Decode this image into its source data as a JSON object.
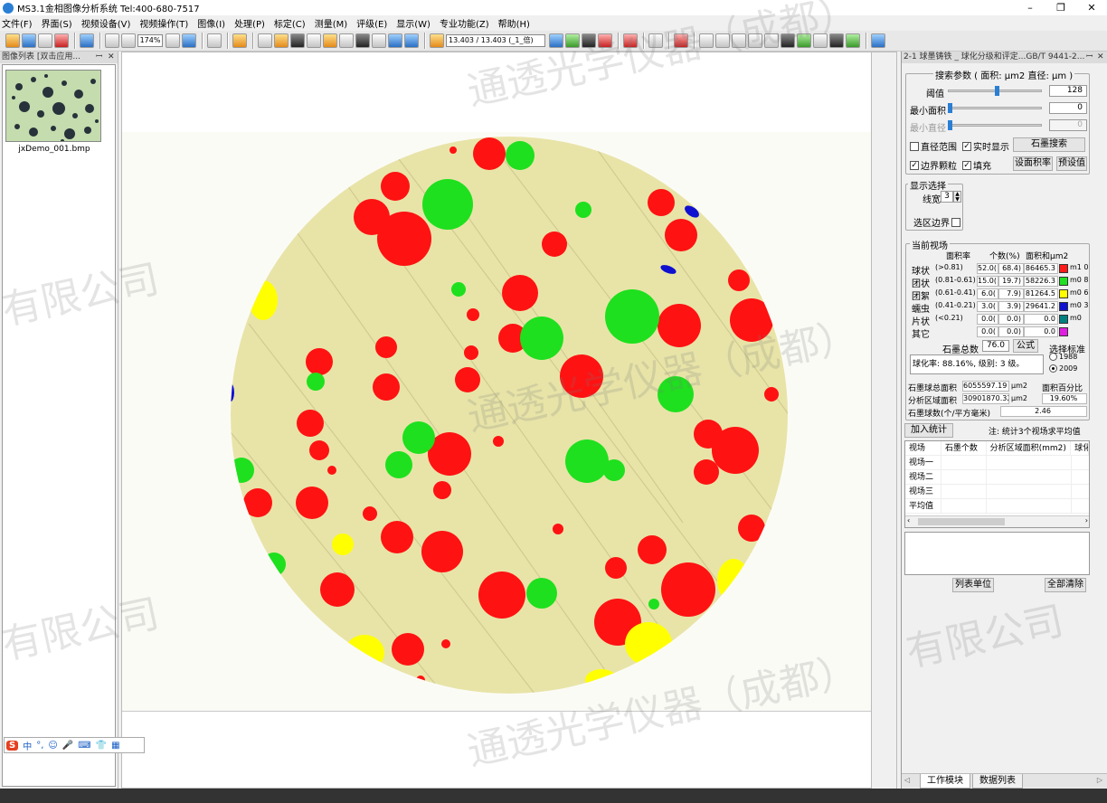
{
  "window": {
    "title": "MS3.1金相图像分析系统 Tel:400-680-7517",
    "controls": [
      "–",
      "❐",
      "✕"
    ]
  },
  "menu": [
    "文件(F)",
    "界面(S)",
    "视频设备(V)",
    "视频操作(T)",
    "图像(I)",
    "处理(P)",
    "标定(C)",
    "测量(M)",
    "评级(E)",
    "显示(W)",
    "专业功能(Z)",
    "帮助(H)"
  ],
  "toolbar": {
    "zoom": "174%",
    "scale": "13.403 / 13.403 (_1_倍)"
  },
  "left_panel": {
    "title": "图像列表 [双击应用...",
    "pin": "ꟷ",
    "close": "✕",
    "thumb_name": "jxDemo_001.bmp"
  },
  "ime": {
    "logo": "S",
    "items": [
      "中",
      "°,",
      "☺",
      "🎤",
      "⌨",
      "👕",
      "▦"
    ]
  },
  "right_panel": {
    "title": "2-1 球墨铸铁 _ 球化分级和评定...GB/T 9441-2...",
    "search": {
      "group": "搜索参数 ( 面积: μm2 直径: μm )",
      "threshold_label": "阈值",
      "threshold_value": "128",
      "threshold_fraction": 0.5,
      "min_area_label": "最小面积",
      "min_area_value": "0",
      "min_diam_label": "最小直径",
      "min_diam_value": "0",
      "diam_range_label": "直径范围",
      "realtime_label": "实时显示",
      "search_button": "石墨搜索",
      "edge_label": "边界颗粒",
      "fill_label": "填充",
      "set_area_button": "设面积率",
      "preset_button": "预设值"
    },
    "display": {
      "group": "显示选择",
      "linewidth_label": "线宽",
      "linewidth_value": "3",
      "border_label": "选区边界"
    },
    "current": {
      "group": "当前视场",
      "col_area_ratio": "面积率",
      "col_count": "个数(%)",
      "col_area": "面积和μm2",
      "rows": [
        {
          "label": "球状",
          "range": "(>0.81)",
          "a": "52.0(",
          "b": "68.4)",
          "area": "86465.3",
          "color": "#ff1a1a",
          "extra": "m1 0"
        },
        {
          "label": "团状",
          "range": "(0.81-0.61)",
          "a": "15.0(",
          "b": "19.7)",
          "area": "58226.3",
          "color": "#22e022",
          "extra": "m0 8"
        },
        {
          "label": "团絮",
          "range": "(0.61-0.41)",
          "a": "6.0(",
          "b": "7.9)",
          "area": "81264.5",
          "color": "#ffff00",
          "extra": "m0 6"
        },
        {
          "label": "蠕虫",
          "range": "(0.41-0.21)",
          "a": "3.0(",
          "b": "3.9)",
          "area": "29641.2",
          "color": "#1010d0",
          "extra": "m0 3"
        },
        {
          "label": "片状",
          "range": "(<0.21)",
          "a": "0.0(",
          "b": "0.0)",
          "area": "0.0",
          "color": "#008080",
          "extra": "m0"
        },
        {
          "label": "其它",
          "range": "",
          "a": "0.0(",
          "b": "0.0)",
          "area": "0.0",
          "color": "#e020e0",
          "extra": ""
        }
      ],
      "total_label": "石墨总数",
      "total_value": "76.0",
      "formula_button": "公式",
      "standard_label": "选择标准",
      "std_1988": "1988",
      "std_2009": "2009",
      "result_text": "球化率: 88.16%, 级别: 3 级。",
      "graphite_area_label": "石墨球总面积",
      "graphite_area_value": "6055597.19",
      "unit1": "μm2",
      "area_percent_label": "面积百分比",
      "analysis_area_label": "分析区域面积",
      "analysis_area_value": "30901870.32",
      "unit2": "μm2",
      "area_percent_value": "19.60%",
      "count_per_mm_label": "石墨球数(个/平方毫米)",
      "count_per_mm_value": "2.46"
    },
    "stats": {
      "add_button": "加入统计",
      "note": "注: 统计3个视场求平均值",
      "columns": [
        "视场",
        "石墨个数",
        "分析区域面积(mm2)",
        "球化"
      ],
      "rows": [
        "视场一",
        "视场二",
        "视场三",
        "平均值"
      ]
    },
    "list_unit_button": "列表单位",
    "clear_button": "全部清除",
    "tabs": [
      "工作模块",
      "数据列表"
    ]
  },
  "watermarks": [
    "通透光学仪器（成都）",
    "有限公司",
    "通透光学仪器（成都）",
    "有限公司",
    "通透光学仪器（成都）",
    "有限公司"
  ]
}
